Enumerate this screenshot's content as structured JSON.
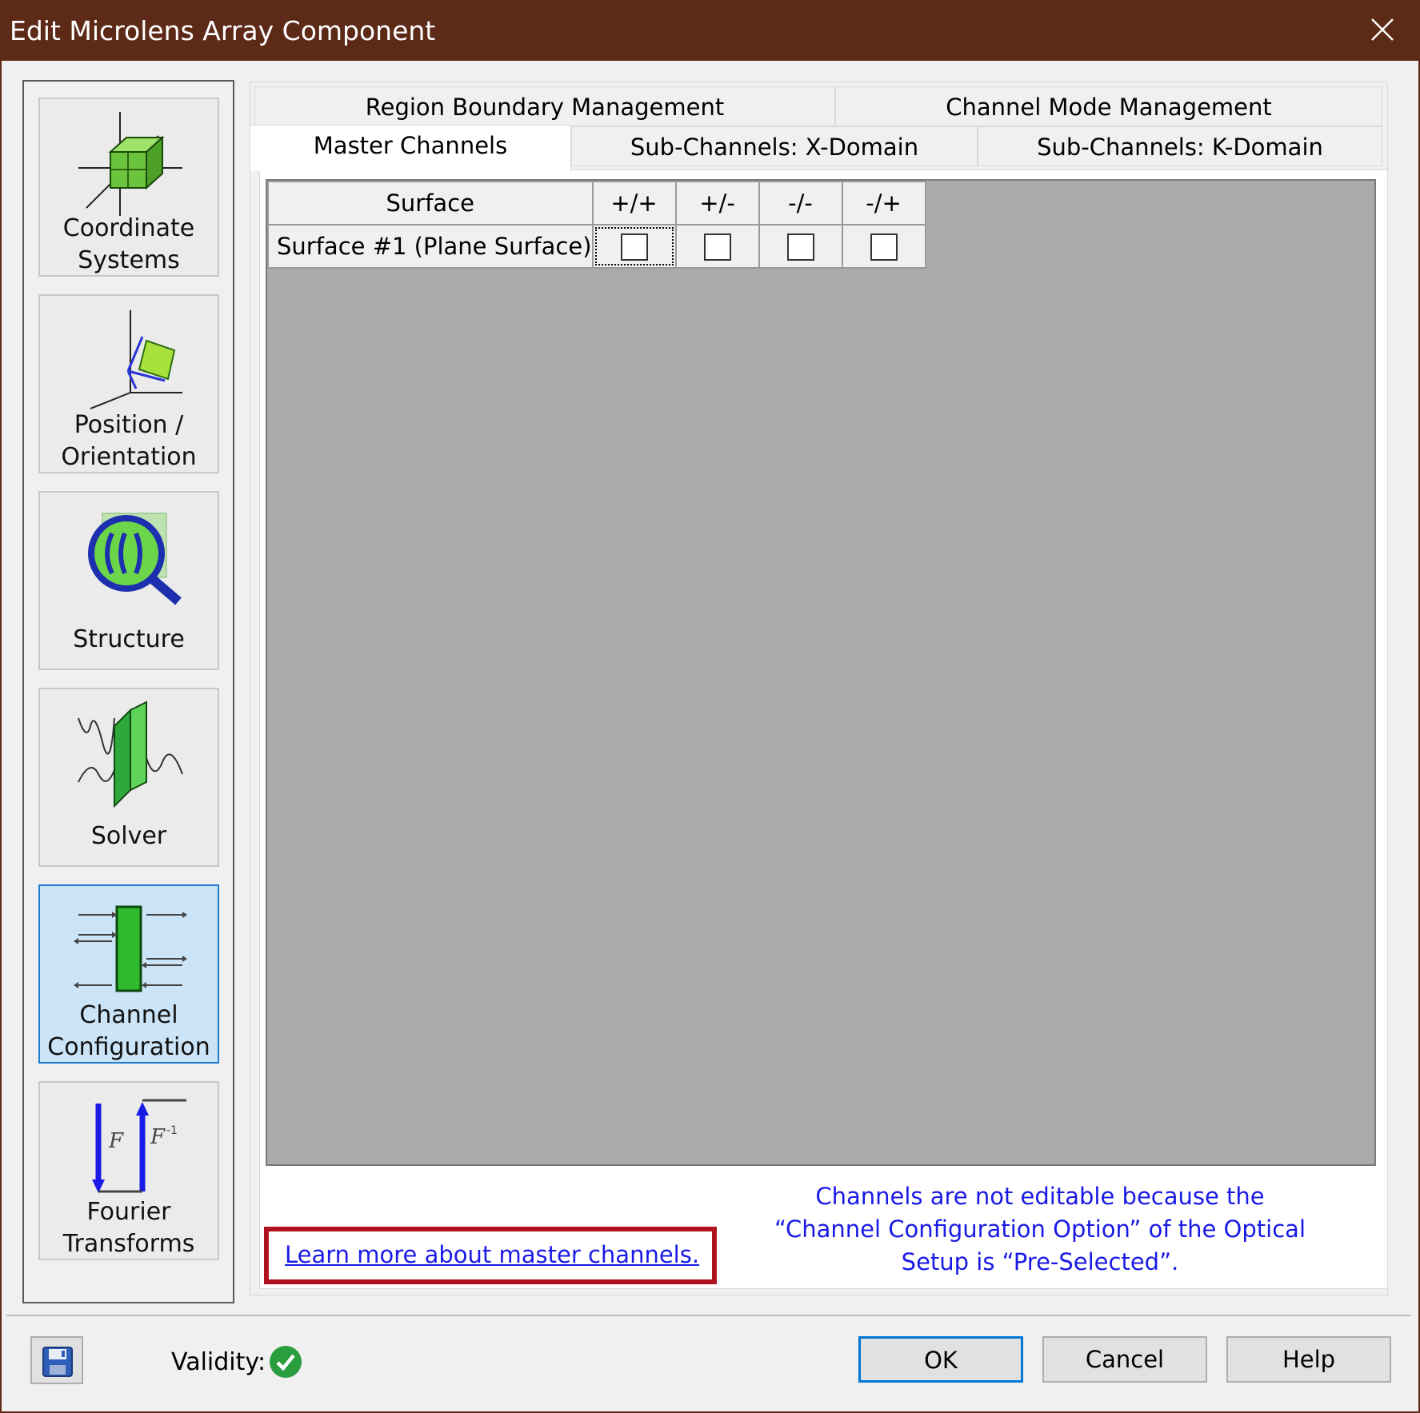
{
  "window": {
    "title": "Edit Microlens Array Component"
  },
  "nav": {
    "items": [
      {
        "label": "Coordinate\nSystems"
      },
      {
        "label": "Position /\nOrientation"
      },
      {
        "label": "Structure"
      },
      {
        "label": "Solver"
      },
      {
        "label": "Channel\nConfiguration",
        "selected": true
      },
      {
        "label": "Fourier\nTransforms"
      }
    ]
  },
  "tabs": {
    "row1": [
      "Region Boundary Management",
      "Channel Mode Management"
    ],
    "row2": [
      "Master Channels",
      "Sub-Channels: X-Domain",
      "Sub-Channels: K-Domain"
    ],
    "active": "Master Channels"
  },
  "table": {
    "columns": [
      "Surface",
      "+/+",
      "+/-",
      "-/-",
      "-/+"
    ],
    "rows": [
      {
        "surface": "Surface #1 (Plane Surface)",
        "checked": [
          false,
          false,
          false,
          false
        ]
      }
    ]
  },
  "learn_link": "Learn more about master channels.",
  "info": "Channels are not editable because the “Channel Configuration Option” of the Optical Setup is “Pre-Selected”.",
  "footer": {
    "validity_label": "Validity:",
    "validity_status": "valid",
    "ok_label": "OK",
    "cancel_label": "Cancel",
    "help_label": "Help"
  },
  "colors": {
    "titlebar": "#5c2a17",
    "link": "#1a1ae6",
    "highlight_box": "#b0131f",
    "selected_nav": "#cce4f7"
  }
}
